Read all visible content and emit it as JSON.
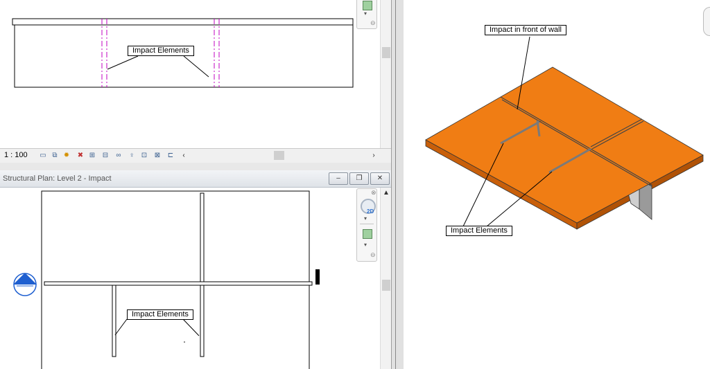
{
  "top_view": {
    "scale": "1 : 100",
    "annotation": "Impact Elements"
  },
  "plan_view": {
    "title": "Structural Plan: Level 2 - Impact",
    "annotation": "Impact Elements",
    "buttons": {
      "minimize": "–",
      "restore": "❐",
      "close": "✕"
    }
  },
  "view_3d": {
    "annotation_top": "Impact in front of wall",
    "annotation_bottom": "Impact Elements",
    "slab_color": "#f07d14"
  },
  "nav": {
    "two_d_label": "2D"
  },
  "icons": [
    "model-graphics-icon",
    "visual-style-icon",
    "sun-path-icon",
    "shadows-icon",
    "crop-icon",
    "show-crop-icon",
    "temporary-hide-icon",
    "reveal-icon",
    "analytical-icon",
    "highlight-icon",
    "constraints-icon"
  ]
}
